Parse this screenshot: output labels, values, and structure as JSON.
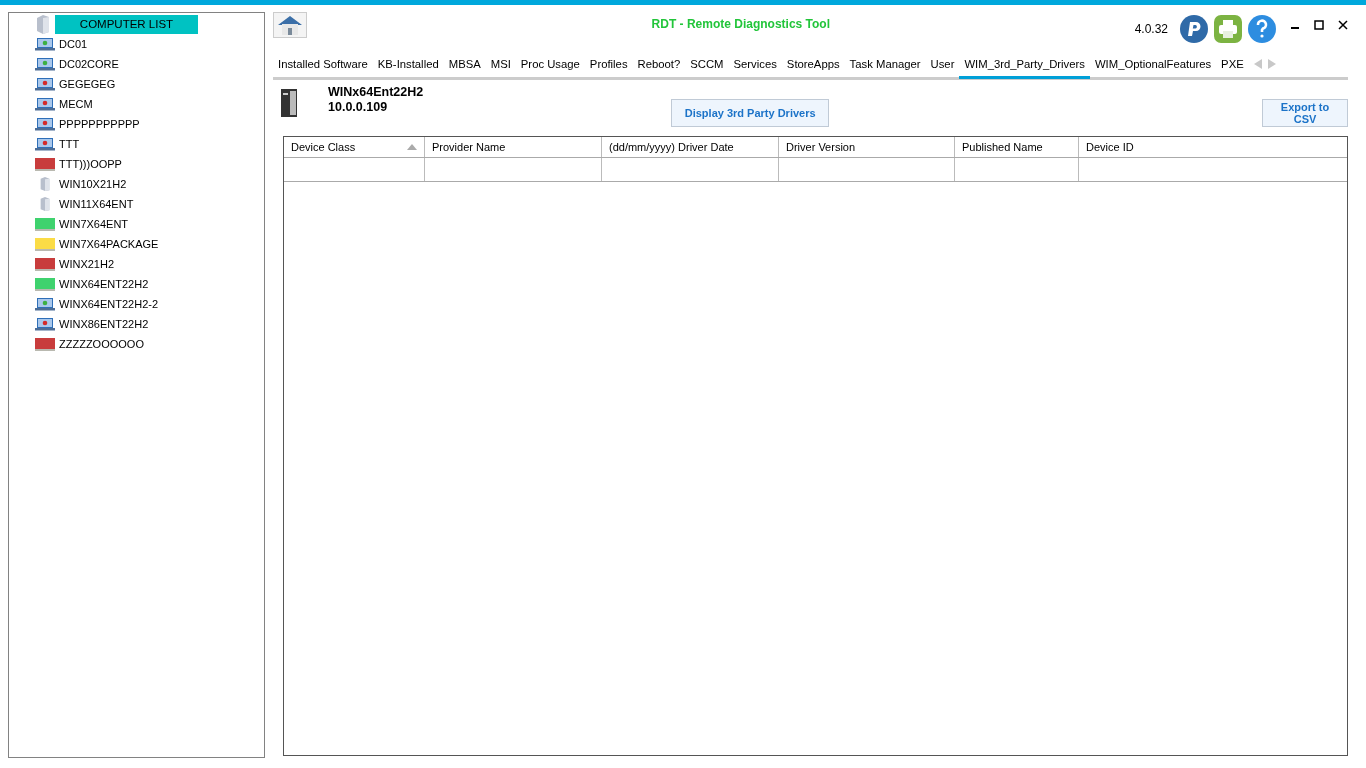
{
  "window": {
    "title": "RDT - Remote Diagnostics Tool",
    "version": "4.0.32"
  },
  "computer_list": {
    "title": "COMPUTER LIST",
    "items": [
      {
        "name": "DC01",
        "kind": "laptop",
        "color": "#3cb043"
      },
      {
        "name": "DC02CORE",
        "kind": "laptop",
        "color": "#3cb043"
      },
      {
        "name": "GEGEGEG",
        "kind": "laptop",
        "color": "#d42a2a"
      },
      {
        "name": "MECM",
        "kind": "laptop",
        "color": "#d42a2a"
      },
      {
        "name": "PPPPPPPPPPP",
        "kind": "laptop",
        "color": "#d42a2a"
      },
      {
        "name": "TTT",
        "kind": "laptop",
        "color": "#d42a2a"
      },
      {
        "name": "TTT)))OOPP",
        "kind": "block",
        "color": "#c83c3c"
      },
      {
        "name": "WIN10X21H2",
        "kind": "server"
      },
      {
        "name": "WIN11X64ENT",
        "kind": "server"
      },
      {
        "name": "WIN7X64ENT",
        "kind": "block",
        "color": "#3fd26e"
      },
      {
        "name": "WIN7X64PACKAGE",
        "kind": "block",
        "color": "#fbdc46"
      },
      {
        "name": "WINX21H2",
        "kind": "block",
        "color": "#c83c3c"
      },
      {
        "name": "WINX64ENT22H2",
        "kind": "block",
        "color": "#3fd26e"
      },
      {
        "name": "WINX64ENT22H2-2",
        "kind": "laptop",
        "color": "#3cb043"
      },
      {
        "name": "WINX86ENT22H2",
        "kind": "laptop",
        "color": "#d42a2a"
      },
      {
        "name": "ZZZZZOOOOOO",
        "kind": "block",
        "color": "#c83c3c"
      }
    ]
  },
  "tabs": [
    {
      "label": "Installed Software",
      "selected": false
    },
    {
      "label": "KB-Installed",
      "selected": false
    },
    {
      "label": "MBSA",
      "selected": false
    },
    {
      "label": "MSI",
      "selected": false
    },
    {
      "label": "Proc Usage",
      "selected": false
    },
    {
      "label": "Profiles",
      "selected": false
    },
    {
      "label": "Reboot?",
      "selected": false
    },
    {
      "label": "SCCM",
      "selected": false
    },
    {
      "label": "Services",
      "selected": false
    },
    {
      "label": "StoreApps",
      "selected": false
    },
    {
      "label": "Task Manager",
      "selected": false
    },
    {
      "label": "User",
      "selected": false
    },
    {
      "label": "WIM_3rd_Party_Drivers",
      "selected": true
    },
    {
      "label": "WIM_OptionalFeatures",
      "selected": false
    },
    {
      "label": "PXE",
      "selected": false
    }
  ],
  "machine": {
    "name": "WINx64Ent22H2",
    "ip": "10.0.0.109"
  },
  "buttons": {
    "display": "Display 3rd Party Drivers",
    "export": "Export to CSV"
  },
  "table": {
    "columns": [
      {
        "label": "Device Class",
        "sorted": true
      },
      {
        "label": "Provider Name",
        "sorted": false
      },
      {
        "label": "(dd/mm/yyyy) Driver Date",
        "sorted": false
      },
      {
        "label": "Driver Version",
        "sorted": false
      },
      {
        "label": "Published Name",
        "sorted": false
      },
      {
        "label": "Device ID",
        "sorted": false
      }
    ]
  }
}
